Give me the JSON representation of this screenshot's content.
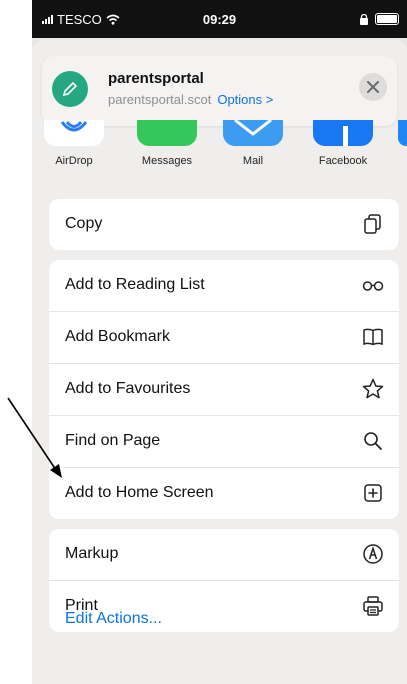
{
  "status": {
    "carrier": "TESCO",
    "time": "09:29"
  },
  "header": {
    "title": "parentsportal",
    "url": "parentsportal.scot",
    "options": "Options >"
  },
  "apps": [
    {
      "label": "AirDrop",
      "color": "#ffffff"
    },
    {
      "label": "Messages",
      "color": "#34c759"
    },
    {
      "label": "Mail",
      "color": "#3b9cf2"
    },
    {
      "label": "Facebook",
      "color": "#1877f2"
    }
  ],
  "group1": [
    {
      "label": "Copy",
      "icon": "copy-icon"
    }
  ],
  "group2": [
    {
      "label": "Add to Reading List",
      "icon": "glasses-icon"
    },
    {
      "label": "Add Bookmark",
      "icon": "book-icon"
    },
    {
      "label": "Add to Favourites",
      "icon": "star-icon"
    },
    {
      "label": "Find on Page",
      "icon": "search-icon"
    },
    {
      "label": "Add to Home Screen",
      "icon": "add-square-icon"
    }
  ],
  "group3": [
    {
      "label": "Markup",
      "icon": "markup-icon"
    },
    {
      "label": "Print",
      "icon": "printer-icon"
    }
  ],
  "edit_actions": "Edit Actions..."
}
